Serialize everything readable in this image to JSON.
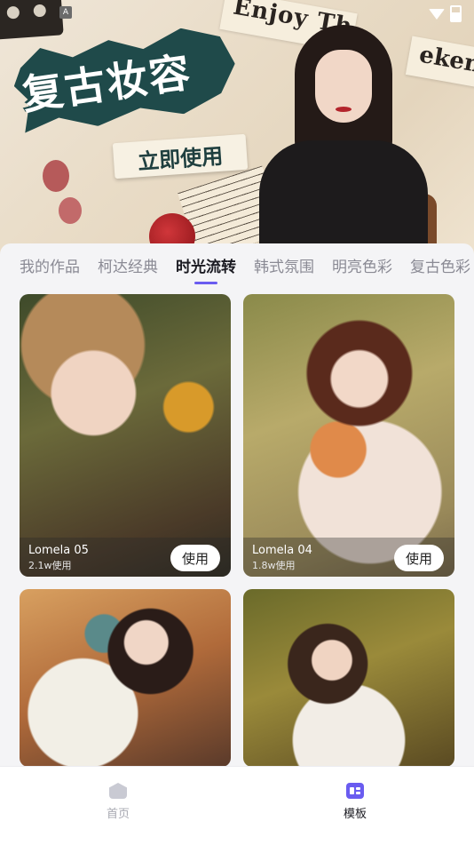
{
  "status_bar": {
    "badge": "A",
    "wifi_icon": "wifi-icon",
    "battery_icon": "battery-icon"
  },
  "banner": {
    "deco_text_1": "Enjoy Th",
    "deco_text_2": "ekend",
    "title": "复古妆容",
    "cta": "立即使用"
  },
  "tabs": [
    {
      "label": "我的作品",
      "active": false
    },
    {
      "label": "柯达经典",
      "active": false
    },
    {
      "label": "时光流转",
      "active": true
    },
    {
      "label": "韩式氛围",
      "active": false
    },
    {
      "label": "明亮色彩",
      "active": false
    },
    {
      "label": "复古色彩",
      "active": false
    }
  ],
  "cards": [
    {
      "name": "Lomela 05",
      "count": "2.1w使用",
      "button": "使用"
    },
    {
      "name": "Lomela 04",
      "count": "1.8w使用",
      "button": "使用"
    },
    {
      "name": "",
      "count": "",
      "button": ""
    },
    {
      "name": "",
      "count": "",
      "button": ""
    }
  ],
  "nav": {
    "home": {
      "label": "首页",
      "icon": "home-icon",
      "active": false
    },
    "templates": {
      "label": "模板",
      "icon": "template-icon",
      "active": true
    }
  },
  "colors": {
    "accent": "#6a5cf0",
    "title_bg": "#1f4a4a"
  }
}
